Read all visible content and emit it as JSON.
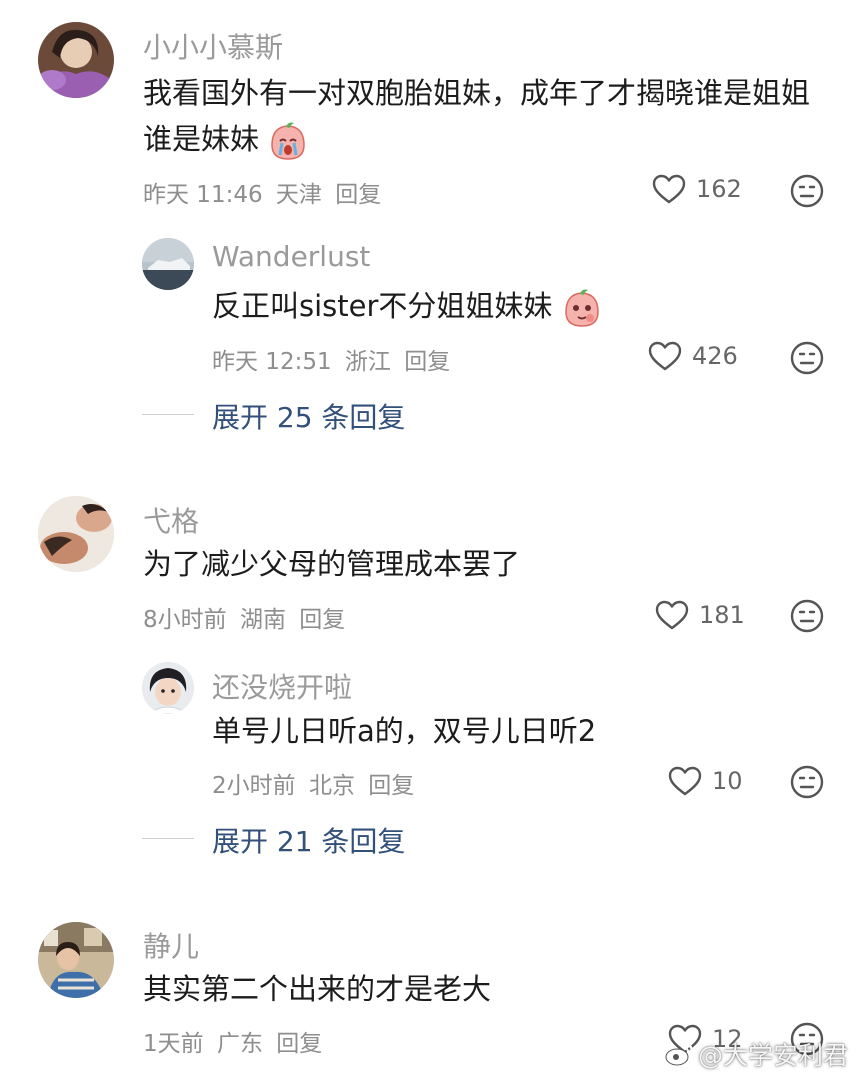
{
  "colors": {
    "link": "#32507a",
    "meta": "#8e8e8e",
    "username": "#9a9a9a"
  },
  "comments": [
    {
      "username": "小小小慕斯",
      "text": "我看国外有一对双胞胎姐妹，成年了才揭晓谁是姐姐谁是妹妹",
      "emoji": "crying-peach-emoji",
      "time": "昨天 11:46",
      "location": "天津",
      "reply_label": "回复",
      "likes": "162",
      "replies": [
        {
          "username": "Wanderlust",
          "text": "反正叫sister不分姐姐妹妹",
          "emoji": "smirking-peach-emoji",
          "time": "昨天 12:51",
          "location": "浙江",
          "reply_label": "回复",
          "likes": "426"
        }
      ],
      "expand_label": "展开 25 条回复"
    },
    {
      "username": "弋格",
      "text": "为了减少父母的管理成本罢了",
      "time": "8小时前",
      "location": "湖南",
      "reply_label": "回复",
      "likes": "181",
      "replies": [
        {
          "username": "还没烧开啦",
          "text": "单号儿日听a的，双号儿日听2",
          "time": "2小时前",
          "location": "北京",
          "reply_label": "回复",
          "likes": "10"
        }
      ],
      "expand_label": "展开 21 条回复"
    },
    {
      "username": "静儿",
      "text": "其实第二个出来的才是老大",
      "time": "1天前",
      "location": "广东",
      "reply_label": "回复",
      "likes": "12"
    }
  ],
  "watermark": "@大学安利君"
}
